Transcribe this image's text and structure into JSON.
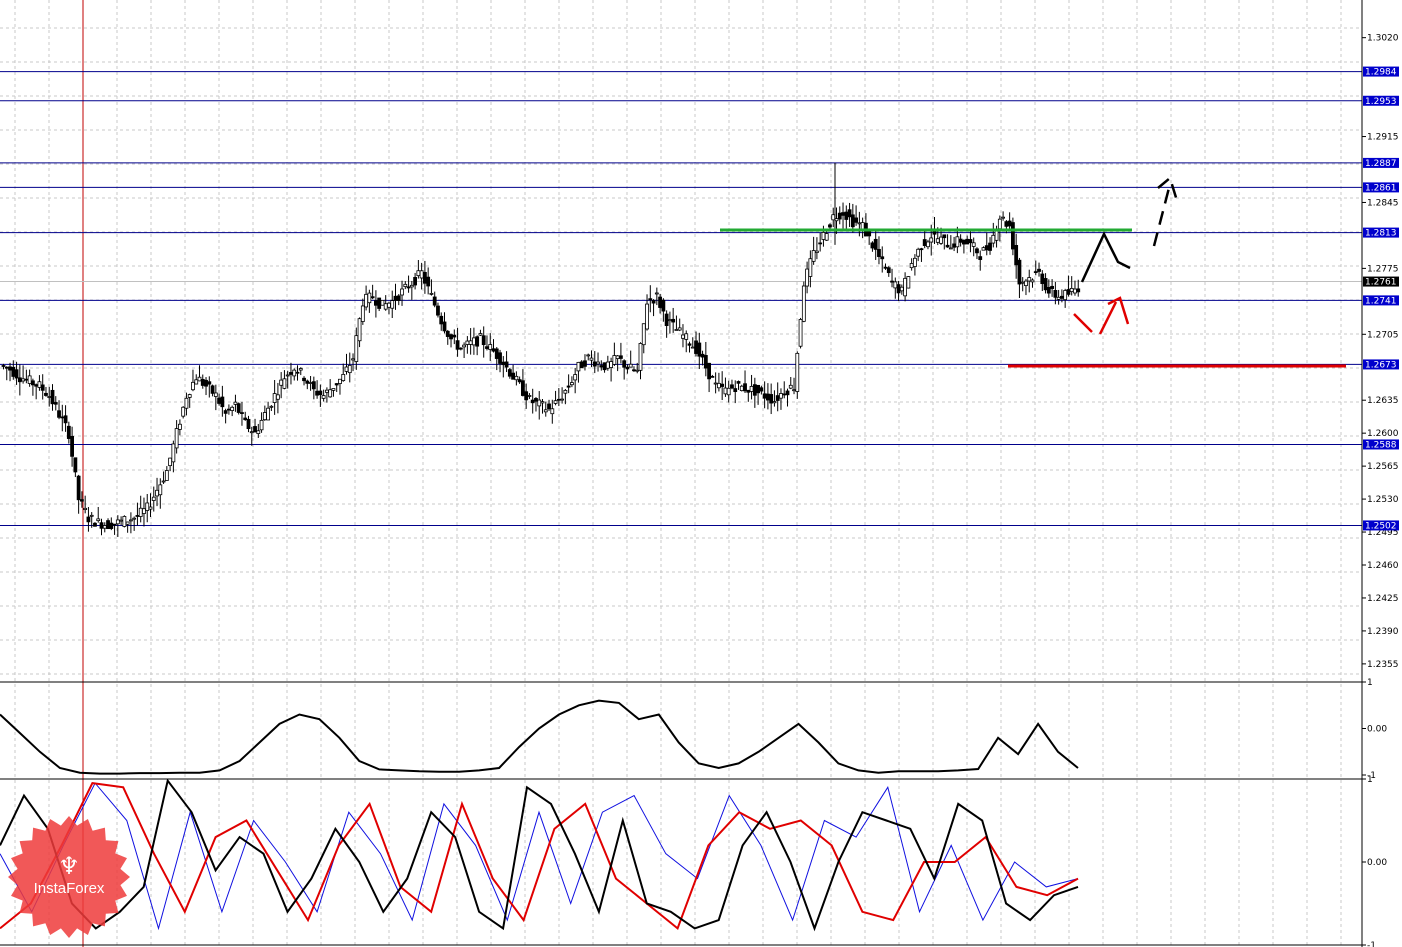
{
  "chart_data": {
    "type": "candlestick",
    "price_axis": {
      "ticks": [
        "1.3020",
        "1.2915",
        "1.2845",
        "1.2775",
        "1.2705",
        "1.2635",
        "1.2600",
        "1.2565",
        "1.2530",
        "1.2495",
        "1.2460",
        "1.2425",
        "1.2390",
        "1.2355"
      ],
      "range": [
        1.234,
        1.306
      ]
    },
    "levels": [
      {
        "label": "1.2984",
        "value": 1.2984,
        "color": "#00008b"
      },
      {
        "label": "1.2953",
        "value": 1.2953,
        "color": "#00008b"
      },
      {
        "label": "1.2887",
        "value": 1.2887,
        "color": "#00008b"
      },
      {
        "label": "1.2861",
        "value": 1.2861,
        "color": "#00008b"
      },
      {
        "label": "1.2813",
        "value": 1.2813,
        "color": "#00008b"
      },
      {
        "label": "1.2741",
        "value": 1.2741,
        "color": "#00008b"
      },
      {
        "label": "1.2673",
        "value": 1.2673,
        "color": "#00008b"
      },
      {
        "label": "1.2588",
        "value": 1.2588,
        "color": "#00008b"
      },
      {
        "label": "1.2502",
        "value": 1.2502,
        "color": "#00008b"
      }
    ],
    "current_price": {
      "label": "1.2761",
      "value": 1.2761
    },
    "price_path": [
      1.2672,
      1.2668,
      1.266,
      1.2655,
      1.265,
      1.264,
      1.262,
      1.26,
      1.253,
      1.251,
      1.2505,
      1.2503,
      1.2505,
      1.2508,
      1.2512,
      1.252,
      1.254,
      1.256,
      1.26,
      1.264,
      1.266,
      1.265,
      1.264,
      1.262,
      1.263,
      1.261,
      1.26,
      1.262,
      1.264,
      1.266,
      1.267,
      1.266,
      1.2645,
      1.264,
      1.265,
      1.266,
      1.268,
      1.274,
      1.2745,
      1.2735,
      1.274,
      1.275,
      1.276,
      1.277,
      1.2745,
      1.272,
      1.27,
      1.269,
      1.2695,
      1.27,
      1.269,
      1.268,
      1.2665,
      1.265,
      1.2635,
      1.263,
      1.2625,
      1.2635,
      1.265,
      1.267,
      1.268,
      1.2675,
      1.267,
      1.268,
      1.267,
      1.2665,
      1.274,
      1.2745,
      1.272,
      1.271,
      1.27,
      1.269,
      1.267,
      1.265,
      1.2645,
      1.265,
      1.2648,
      1.2645,
      1.264,
      1.2635,
      1.2645,
      1.265,
      1.276,
      1.279,
      1.281,
      1.283,
      1.2835,
      1.2825,
      1.282,
      1.28,
      1.278,
      1.276,
      1.275,
      1.278,
      1.28,
      1.281,
      1.2805,
      1.28,
      1.2805,
      1.28,
      1.279,
      1.28,
      1.283,
      1.282,
      1.276,
      1.2765,
      1.277,
      1.275,
      1.2745,
      1.2748,
      1.2755
    ],
    "oscillator_1": {
      "range": [
        -1,
        1
      ],
      "ticks": [
        "1",
        "0.00",
        "-1"
      ],
      "values": [
        0.3,
        -0.1,
        -0.5,
        -0.85,
        -0.95,
        -0.97,
        -0.97,
        -0.96,
        -0.96,
        -0.95,
        -0.95,
        -0.9,
        -0.7,
        -0.3,
        0.1,
        0.3,
        0.2,
        -0.2,
        -0.7,
        -0.88,
        -0.9,
        -0.92,
        -0.93,
        -0.93,
        -0.9,
        -0.85,
        -0.4,
        0.0,
        0.3,
        0.5,
        0.6,
        0.55,
        0.2,
        0.3,
        -0.3,
        -0.75,
        -0.85,
        -0.75,
        -0.5,
        -0.2,
        0.1,
        -0.3,
        -0.75,
        -0.9,
        -0.95,
        -0.92,
        -0.92,
        -0.92,
        -0.9,
        -0.87,
        -0.2,
        -0.55,
        0.1,
        -0.5,
        -0.85
      ]
    },
    "oscillator_2": {
      "range": [
        -1,
        1
      ],
      "ticks": [
        "1",
        "0.00",
        "-1"
      ],
      "black": [
        0.2,
        0.8,
        0.4,
        -0.5,
        -0.8,
        -0.6,
        -0.3,
        0.98,
        0.6,
        -0.1,
        0.3,
        0.1,
        -0.6,
        -0.2,
        0.4,
        0.0,
        -0.6,
        -0.2,
        0.6,
        0.3,
        -0.6,
        -0.8,
        0.9,
        0.7,
        0.1,
        -0.6,
        0.5,
        -0.5,
        -0.6,
        -0.8,
        -0.7,
        0.2,
        0.6,
        0.0,
        -0.8,
        0.0,
        0.6,
        0.5,
        0.4,
        -0.2,
        0.7,
        0.5,
        -0.5,
        -0.7,
        -0.4,
        -0.3
      ],
      "red": [
        -0.8,
        -0.5,
        0.2,
        0.95,
        0.9,
        0.1,
        -0.6,
        0.3,
        0.5,
        -0.1,
        -0.7,
        0.2,
        0.7,
        -0.3,
        -0.6,
        0.7,
        -0.2,
        -0.7,
        0.4,
        0.7,
        -0.2,
        -0.5,
        -0.8,
        0.2,
        0.6,
        0.4,
        0.5,
        0.2,
        -0.6,
        -0.7,
        0.0,
        0.0,
        0.3,
        -0.3,
        -0.4,
        -0.2
      ],
      "blue": [
        0.1,
        -0.6,
        0.2,
        0.95,
        0.5,
        -0.8,
        0.6,
        -0.6,
        0.5,
        0.0,
        -0.6,
        0.6,
        0.1,
        -0.7,
        0.7,
        0.2,
        -0.7,
        0.6,
        -0.5,
        0.6,
        0.8,
        0.1,
        -0.2,
        0.8,
        0.2,
        -0.7,
        0.5,
        0.3,
        0.9,
        -0.6,
        0.2,
        -0.7,
        0.0,
        -0.3,
        -0.2
      ]
    }
  },
  "logo": {
    "text": "InstaForex"
  }
}
